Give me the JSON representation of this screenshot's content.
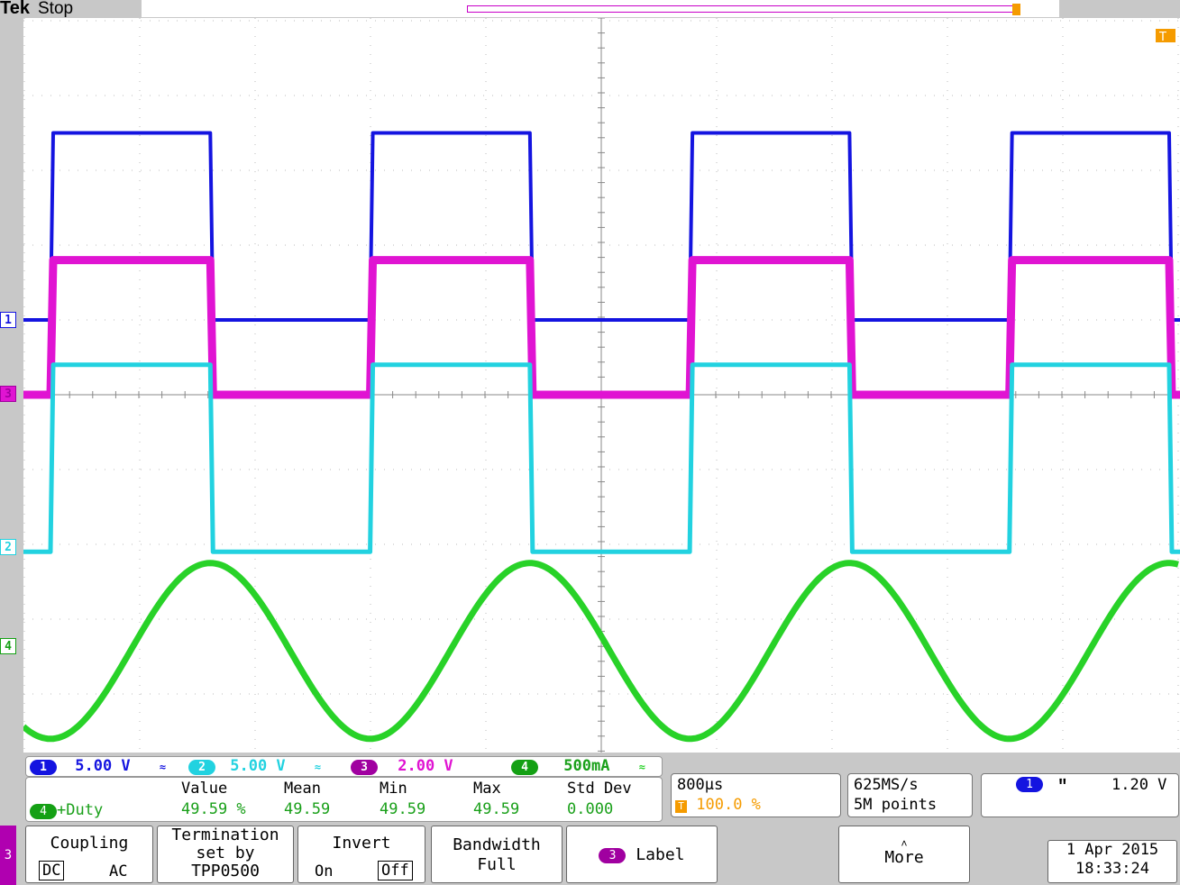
{
  "header": {
    "brand": "Tek",
    "status": "Stop"
  },
  "markers": {
    "ch1": "1",
    "ch2": "2",
    "ch3": "3",
    "ch4": "4",
    "trigger": "T"
  },
  "channels": [
    {
      "id": "1",
      "scale": "5.00 V",
      "color": "#1414e0"
    },
    {
      "id": "2",
      "scale": "5.00 V",
      "color": "#22d2e0"
    },
    {
      "id": "3",
      "scale": "2.00 V",
      "color": "#e014d2"
    },
    {
      "id": "4",
      "scale": "500mA",
      "color": "#28d228"
    }
  ],
  "bw_glyph": "≈",
  "measurement": {
    "headers": {
      "value": "Value",
      "mean": "Mean",
      "min": "Min",
      "max": "Max",
      "std": "Std Dev"
    },
    "source": "4",
    "name": "+Duty",
    "value": "49.59 %",
    "mean": "49.59",
    "min": "49.59",
    "max": "49.59",
    "std": "0.000"
  },
  "timebase": {
    "scale": "800µs",
    "trigger_pos": "100.0 %"
  },
  "acquisition": {
    "rate": "625MS/s",
    "record": "5M points"
  },
  "trigger": {
    "source": "1",
    "slope_glyph": "ʺ",
    "level": "1.20 V"
  },
  "menu": {
    "channel": "3",
    "coupling": {
      "title": "Coupling",
      "dc": "DC",
      "ac": "AC"
    },
    "termination": {
      "line1": "Termination",
      "line2": "set by",
      "line3": "TPP0500"
    },
    "invert": {
      "title": "Invert",
      "on": "On",
      "off": "Off"
    },
    "bandwidth": {
      "title": "Bandwidth",
      "value": "Full"
    },
    "label": {
      "badge": "3",
      "text": "Label"
    },
    "more": "More"
  },
  "datetime": {
    "date": "1 Apr  2015",
    "time": "18:33:24"
  },
  "chart_data": {
    "type": "line",
    "x_unit": "divisions",
    "y_unit": "divisions",
    "period_div": 2.77,
    "series": [
      {
        "name": "1",
        "high": 3.5,
        "low": 1.0
      },
      {
        "name": "2",
        "high": 0.4,
        "low": -2.1
      },
      {
        "name": "3",
        "high": 1.8,
        "low": 0.0
      },
      {
        "name": "4",
        "peak": -2.25,
        "trough": -4.6
      }
    ]
  }
}
